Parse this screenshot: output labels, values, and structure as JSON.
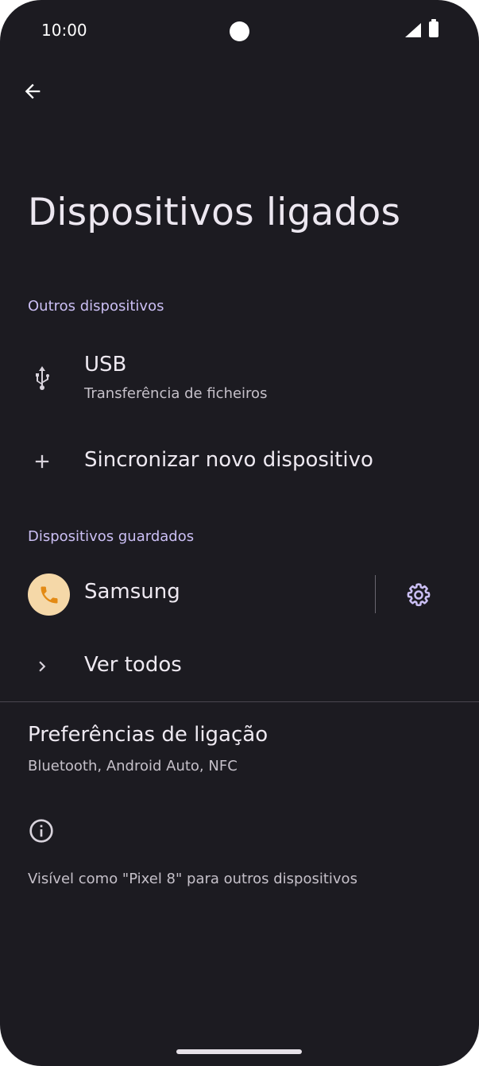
{
  "status": {
    "time": "10:00"
  },
  "header": {
    "title": "Dispositivos ligados"
  },
  "sections": {
    "other": {
      "label": "Outros dispositivos"
    },
    "saved": {
      "label": "Dispositivos guardados"
    }
  },
  "usb": {
    "title": "USB",
    "subtitle": "Transferência de ficheiros"
  },
  "pair": {
    "label": "Sincronizar novo dispositivo"
  },
  "samsung": {
    "label": "Samsung"
  },
  "see_all": {
    "label": "Ver todos"
  },
  "preferences": {
    "title": "Preferências de ligação",
    "subtitle": "Bluetooth, Android Auto, NFC"
  },
  "footer": {
    "visible_text": "Visível como \"Pixel 8\" para outros dispositivos"
  },
  "colors": {
    "background": "#1c1b21",
    "accent_header": "#cbbff4",
    "avatar_bg": "#f5d8a8",
    "avatar_icon": "#e38a14"
  }
}
